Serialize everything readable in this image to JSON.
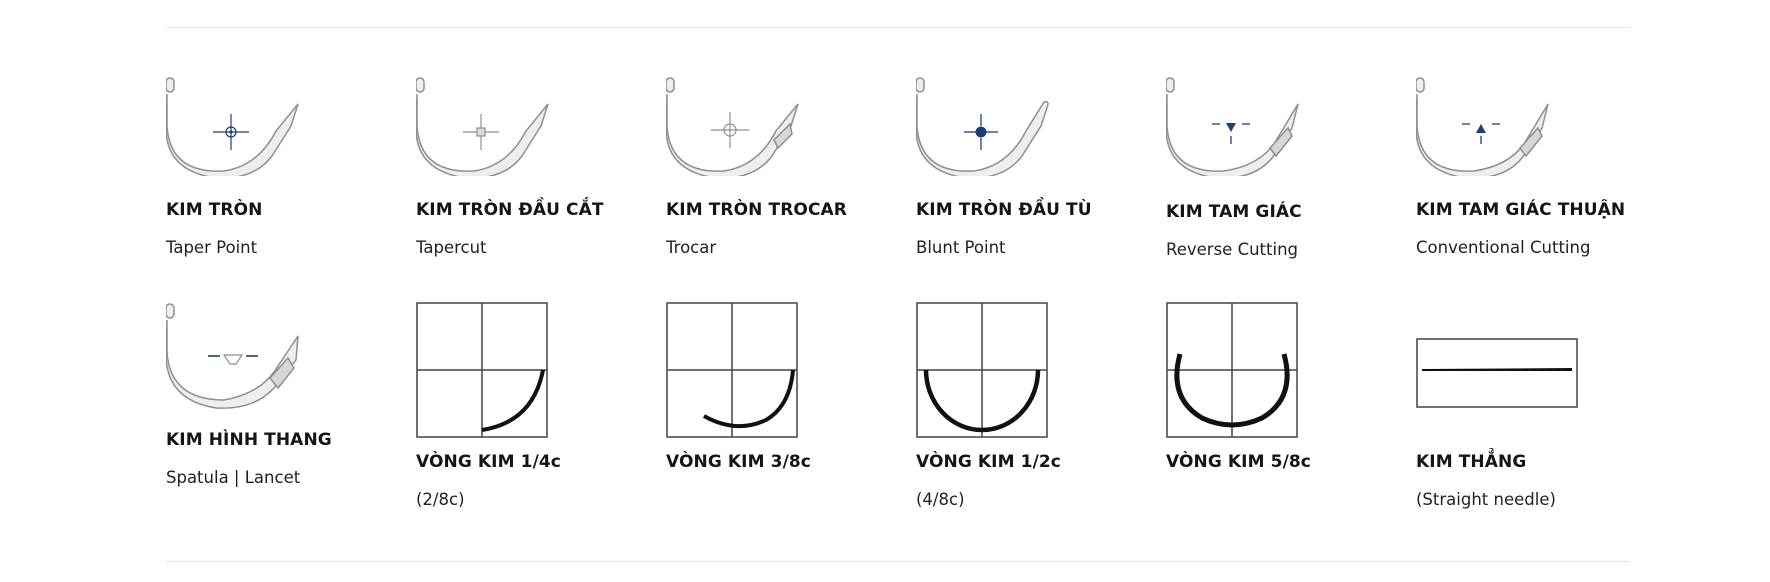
{
  "needle_types": [
    {
      "title": "KIM TRÒN",
      "subtitle": "Taper Point",
      "icon": "taper-point-icon"
    },
    {
      "title": "KIM TRÒN ĐẦU CẮT",
      "subtitle": "Tapercut",
      "icon": "tapercut-icon"
    },
    {
      "title": "KIM TRÒN TROCAR",
      "subtitle": "Trocar",
      "icon": "trocar-icon"
    },
    {
      "title": "KIM TRÒN ĐẦU TÙ",
      "subtitle": "Blunt Point",
      "icon": "blunt-point-icon"
    },
    {
      "title": "KIM TAM GIÁC",
      "subtitle": "Reverse Cutting",
      "icon": "reverse-cutting-icon"
    },
    {
      "title": "KIM TAM GIÁC THUẬN",
      "subtitle": "Conventional Cutting",
      "icon": "conventional-cutting-icon"
    },
    {
      "title": "KIM HÌNH THANG",
      "subtitle": "Spatula | Lancet",
      "icon": "spatula-lancet-icon"
    }
  ],
  "needle_curves": [
    {
      "title": "VÒNG KIM 1/4c",
      "subtitle": "(2/8c)",
      "icon": "quarter-circle-curve-icon"
    },
    {
      "title": "VÒNG KIM 3/8c",
      "subtitle": "",
      "icon": "three-eighths-circle-curve-icon"
    },
    {
      "title": "VÒNG KIM 1/2c",
      "subtitle": "(4/8c)",
      "icon": "half-circle-curve-icon"
    },
    {
      "title": "VÒNG KIM 5/8c",
      "subtitle": "",
      "icon": "five-eighths-circle-curve-icon"
    },
    {
      "title": "KIM THẲNG",
      "subtitle": "(Straight needle)",
      "icon": "straight-needle-icon"
    }
  ],
  "colors": {
    "accent": "#1c3f75",
    "needle_outline": "#8e8e93",
    "needle_fill": "#eeeef0",
    "text": "#151515"
  }
}
